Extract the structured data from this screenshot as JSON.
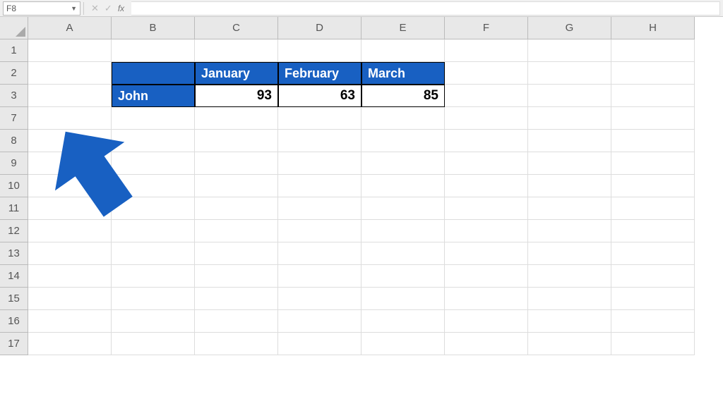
{
  "nameBox": "F8",
  "fxLabel": "fx",
  "columns": [
    "A",
    "B",
    "C",
    "D",
    "E",
    "F",
    "G",
    "H"
  ],
  "rows": [
    "1",
    "2",
    "3",
    "7",
    "8",
    "9",
    "10",
    "11",
    "12",
    "13",
    "14",
    "15",
    "16",
    "17"
  ],
  "table": {
    "headers": {
      "blank": "",
      "jan": "January",
      "feb": "February",
      "mar": "March"
    },
    "row1": {
      "name": "John",
      "jan": "93",
      "feb": "63",
      "mar": "85"
    }
  },
  "chart_data": {
    "type": "table",
    "title": "",
    "categories": [
      "January",
      "February",
      "March"
    ],
    "series": [
      {
        "name": "John",
        "values": [
          93,
          63,
          85
        ]
      }
    ]
  }
}
